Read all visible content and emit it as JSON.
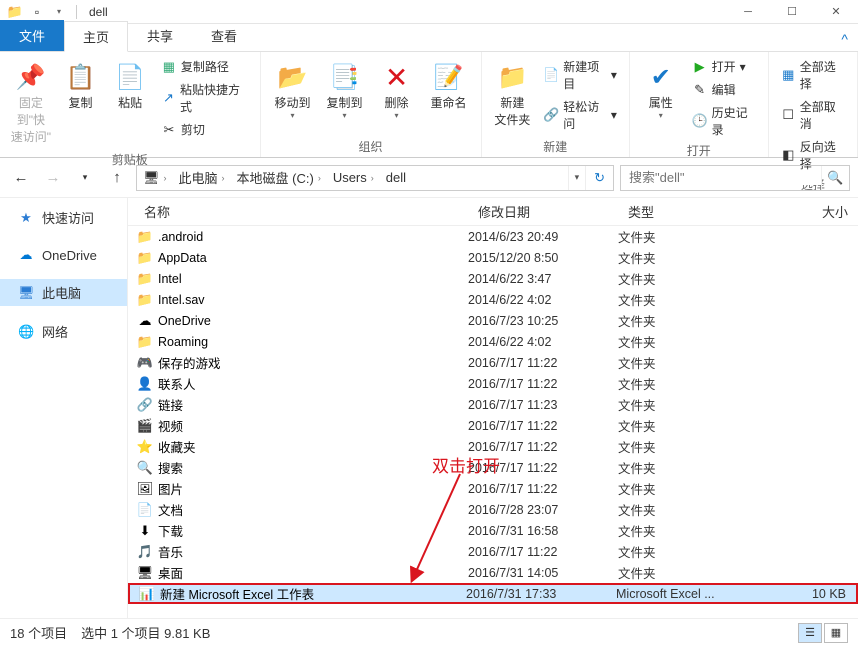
{
  "title": "dell",
  "tabs": {
    "file": "文件",
    "home": "主页",
    "share": "共享",
    "view": "查看"
  },
  "ribbon": {
    "pin": "固定到\"快\n速访问\"",
    "copy": "复制",
    "paste": "粘贴",
    "copy_path": "复制路径",
    "paste_shortcut": "粘贴快捷方式",
    "cut": "剪切",
    "clipboard": "剪贴板",
    "move_to": "移动到",
    "copy_to": "复制到",
    "delete": "删除",
    "rename": "重命名",
    "organize": "组织",
    "new_folder": "新建\n文件夹",
    "new_item": "新建项目",
    "easy_access": "轻松访问",
    "new": "新建",
    "properties": "属性",
    "open": "打开",
    "edit": "编辑",
    "history": "历史记录",
    "open_group": "打开",
    "select_all": "全部选择",
    "select_none": "全部取消",
    "invert": "反向选择",
    "select": "选择"
  },
  "breadcrumb": [
    "此电脑",
    "本地磁盘 (C:)",
    "Users",
    "dell"
  ],
  "search_placeholder": "搜索\"dell\"",
  "columns": {
    "name": "名称",
    "date": "修改日期",
    "type": "类型",
    "size": "大小"
  },
  "sidebar": [
    {
      "icon": "★",
      "label": "快速访问",
      "color": "#2b7cd3"
    },
    {
      "icon": "☁",
      "label": "OneDrive",
      "color": "#0078d4"
    },
    {
      "icon": "🖥",
      "label": "此电脑",
      "color": "#2b7cd3",
      "selected": true
    },
    {
      "icon": "🌐",
      "label": "网络",
      "color": "#2b7cd3"
    }
  ],
  "files": [
    {
      "icon": "📁",
      "name": ".android",
      "date": "2014/6/23 20:49",
      "type": "文件夹",
      "size": ""
    },
    {
      "icon": "📁",
      "name": "AppData",
      "date": "2015/12/20 8:50",
      "type": "文件夹",
      "size": ""
    },
    {
      "icon": "📁",
      "name": "Intel",
      "date": "2014/6/22 3:47",
      "type": "文件夹",
      "size": ""
    },
    {
      "icon": "📁",
      "name": "Intel.sav",
      "date": "2014/6/22 4:02",
      "type": "文件夹",
      "size": ""
    },
    {
      "icon": "☁",
      "name": "OneDrive",
      "date": "2016/7/23 10:25",
      "type": "文件夹",
      "size": ""
    },
    {
      "icon": "📁",
      "name": "Roaming",
      "date": "2014/6/22 4:02",
      "type": "文件夹",
      "size": ""
    },
    {
      "icon": "🎮",
      "name": "保存的游戏",
      "date": "2016/7/17 11:22",
      "type": "文件夹",
      "size": ""
    },
    {
      "icon": "👤",
      "name": "联系人",
      "date": "2016/7/17 11:22",
      "type": "文件夹",
      "size": ""
    },
    {
      "icon": "🔗",
      "name": "链接",
      "date": "2016/7/17 11:23",
      "type": "文件夹",
      "size": ""
    },
    {
      "icon": "🎬",
      "name": "视频",
      "date": "2016/7/17 11:22",
      "type": "文件夹",
      "size": ""
    },
    {
      "icon": "⭐",
      "name": "收藏夹",
      "date": "2016/7/17 11:22",
      "type": "文件夹",
      "size": ""
    },
    {
      "icon": "🔍",
      "name": "搜索",
      "date": "2016/7/17 11:22",
      "type": "文件夹",
      "size": ""
    },
    {
      "icon": "🖼",
      "name": "图片",
      "date": "2016/7/17 11:22",
      "type": "文件夹",
      "size": ""
    },
    {
      "icon": "📄",
      "name": "文档",
      "date": "2016/7/28 23:07",
      "type": "文件夹",
      "size": ""
    },
    {
      "icon": "⬇",
      "name": "下载",
      "date": "2016/7/31 16:58",
      "type": "文件夹",
      "size": ""
    },
    {
      "icon": "🎵",
      "name": "音乐",
      "date": "2016/7/17 11:22",
      "type": "文件夹",
      "size": ""
    },
    {
      "icon": "🖥",
      "name": "桌面",
      "date": "2016/7/31 14:05",
      "type": "文件夹",
      "size": ""
    },
    {
      "icon": "📊",
      "name": "新建 Microsoft Excel 工作表",
      "date": "2016/7/31 17:33",
      "type": "Microsoft Excel ...",
      "size": "10 KB",
      "selected": true
    }
  ],
  "annotation_text": "双击打开",
  "status": {
    "count": "18 个项目",
    "selected": "选中 1 个项目  9.81 KB"
  }
}
